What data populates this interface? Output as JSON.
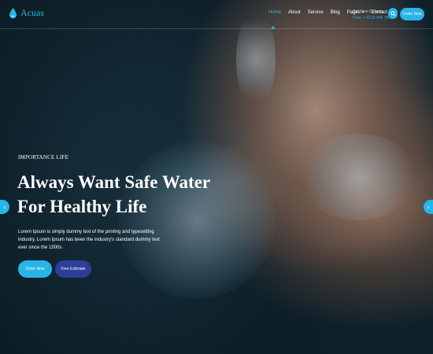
{
  "header": {
    "logo_text": "Acuas",
    "nav": [
      {
        "label": "Home",
        "active": true
      },
      {
        "label": "About",
        "active": false
      },
      {
        "label": "Service",
        "active": false
      },
      {
        "label": "Blog",
        "active": false
      },
      {
        "label": "Pages",
        "active": false,
        "dropdown": true
      },
      {
        "label": "Contact",
        "active": false
      }
    ],
    "delivery_label": "Get Free Delivery",
    "delivery_phone": "Free: + 0123 456 7890",
    "search_icon": "search-icon",
    "order_button": "Order Now"
  },
  "hero": {
    "subtitle": "IMPORTANCE LIFE",
    "title_line1": "Always Want Safe Water",
    "title_line2": "For Healthy Life",
    "description": "Lorem Ipsum is simply dummy text of the printing and typesetting industry. Lorem Ipsum has been the industry's standard dummy text ever since the 1500s.",
    "primary_button": "Order Now",
    "secondary_button": "Free Estimate",
    "prev_icon": "chevron-left-icon",
    "next_icon": "chevron-right-icon"
  },
  "colors": {
    "accent": "#27b5e8",
    "secondary": "#2b3f9a",
    "text": "#ffffff"
  }
}
